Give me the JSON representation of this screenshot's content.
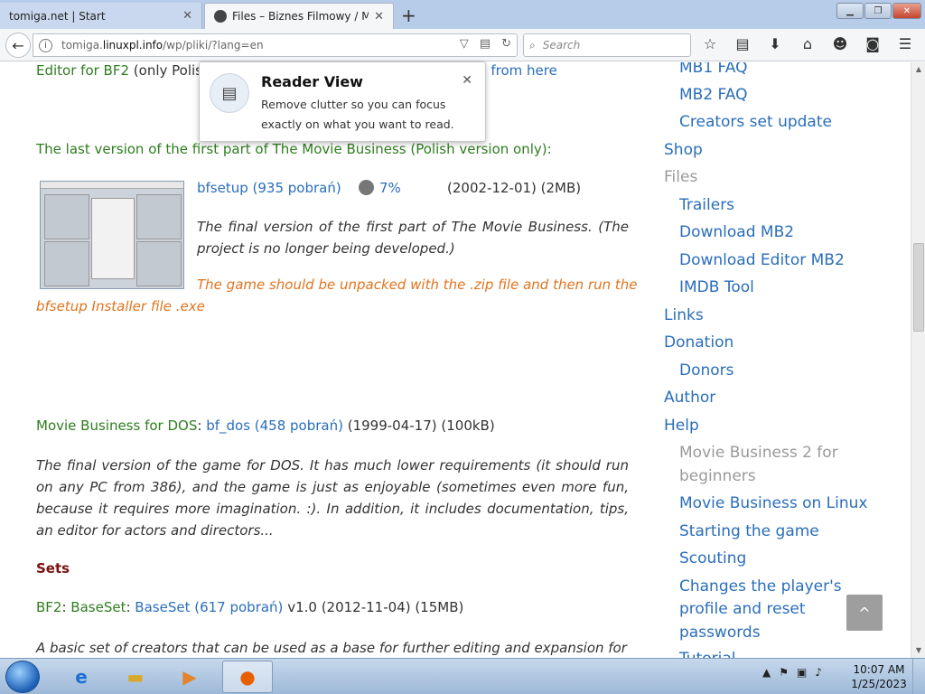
{
  "browser": {
    "tabs": [
      {
        "title": "tomiga.net | Start",
        "active": false
      },
      {
        "title": "Files – Biznes Filmowy / M...",
        "active": true
      }
    ],
    "url_prefix": "tomiga.",
    "url_domain": "linuxpl.info",
    "url_path": "/wp/pliki/?lang=en",
    "search_placeholder": "Search"
  },
  "reader_view": {
    "title": "Reader View",
    "description": "Remove clutter so you can focus exactly on what you want to read."
  },
  "main": {
    "top_line_green": "Editor for BF2",
    "top_line_rest": " (only Polis",
    "top_line_link": "nload from here",
    "last_version_heading": "The last version of the first part of The Movie Business (Polish version only)",
    "last_version_colon": ":",
    "bfsetup_link": "bfsetup (935 pobrań)",
    "bfsetup_percent": "7%",
    "bfsetup_meta": "(2002-12-01) (2MB)",
    "bfsetup_desc": "The final version of the first part of The Movie Business. (The project is no longer being developed.)",
    "bfsetup_note_1": "The game should be unpacked with the .zip file and then run the",
    "bfsetup_note_2": "bfsetup Installer file .exe",
    "dos_label": "Movie Business for DOS",
    "dos_colon": ": ",
    "dos_link": "bf_dos (458 pobrań)",
    "dos_meta": " (1999-04-17) (100kB)",
    "dos_desc": "The final version of the game for DOS. It has much lower requirements (it should run on any PC from 386), and the game is just as enjoyable (sometimes even more fun, because it requires more imagination. :). In addition, it includes documentation, tips, an editor for actors and directors...",
    "sets_heading": "Sets",
    "bf2_label": "BF2",
    "bf2_sep": ": ",
    "baseset_label": "BaseSet",
    "baseset_sep": ": ",
    "baseset_link": "BaseSet (617 pobrań)",
    "baseset_meta": " v1.0 (2012-11-04) (15MB)",
    "baseset_desc": "A basic set of creators that can be used as a base for further editing and expansion for"
  },
  "sidebar": {
    "items": [
      "MB1 FAQ",
      "MB2 FAQ",
      "Creators set update",
      "Shop",
      "Files",
      "Trailers",
      "Download MB2",
      "Download Editor MB2",
      "IMDB Tool",
      "Links",
      "Donation",
      "Donors",
      "Author",
      "Help",
      "Movie Business 2 for",
      "beginners",
      "Movie Business on Linux",
      "Starting the game",
      "Scouting",
      "Changes the player's",
      "profile and reset",
      "passwords",
      "Tutorial"
    ]
  },
  "taskbar": {
    "time": "10:07 AM",
    "date": "1/25/2023"
  }
}
